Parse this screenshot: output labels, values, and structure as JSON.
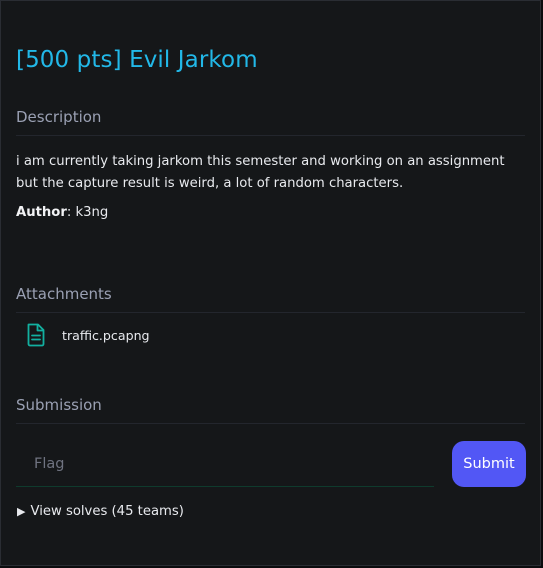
{
  "challenge": {
    "title": "[500 pts] Evil Jarkom"
  },
  "description": {
    "heading": "Description",
    "text": "i am currently taking jarkom this semester and working on an assignment but the capture result is weird, a lot of random characters.",
    "author_label": "Author",
    "author_sep": ":",
    "author_value": "k3ng"
  },
  "attachments": {
    "heading": "Attachments",
    "files": [
      {
        "name": "traffic.pcapng",
        "icon": "file-document-icon"
      }
    ]
  },
  "submission": {
    "heading": "Submission",
    "flag_placeholder": "Flag",
    "flag_value": "",
    "submit_label": "Submit",
    "view_solves_label": "View solves (45 teams)",
    "expand_icon": "triangle-right-icon"
  },
  "colors": {
    "title": "#22b8e8",
    "section": "#9aa0b3",
    "button": "#5257f5",
    "file_icon": "#12b0a0",
    "panel_bg": "#151719"
  }
}
